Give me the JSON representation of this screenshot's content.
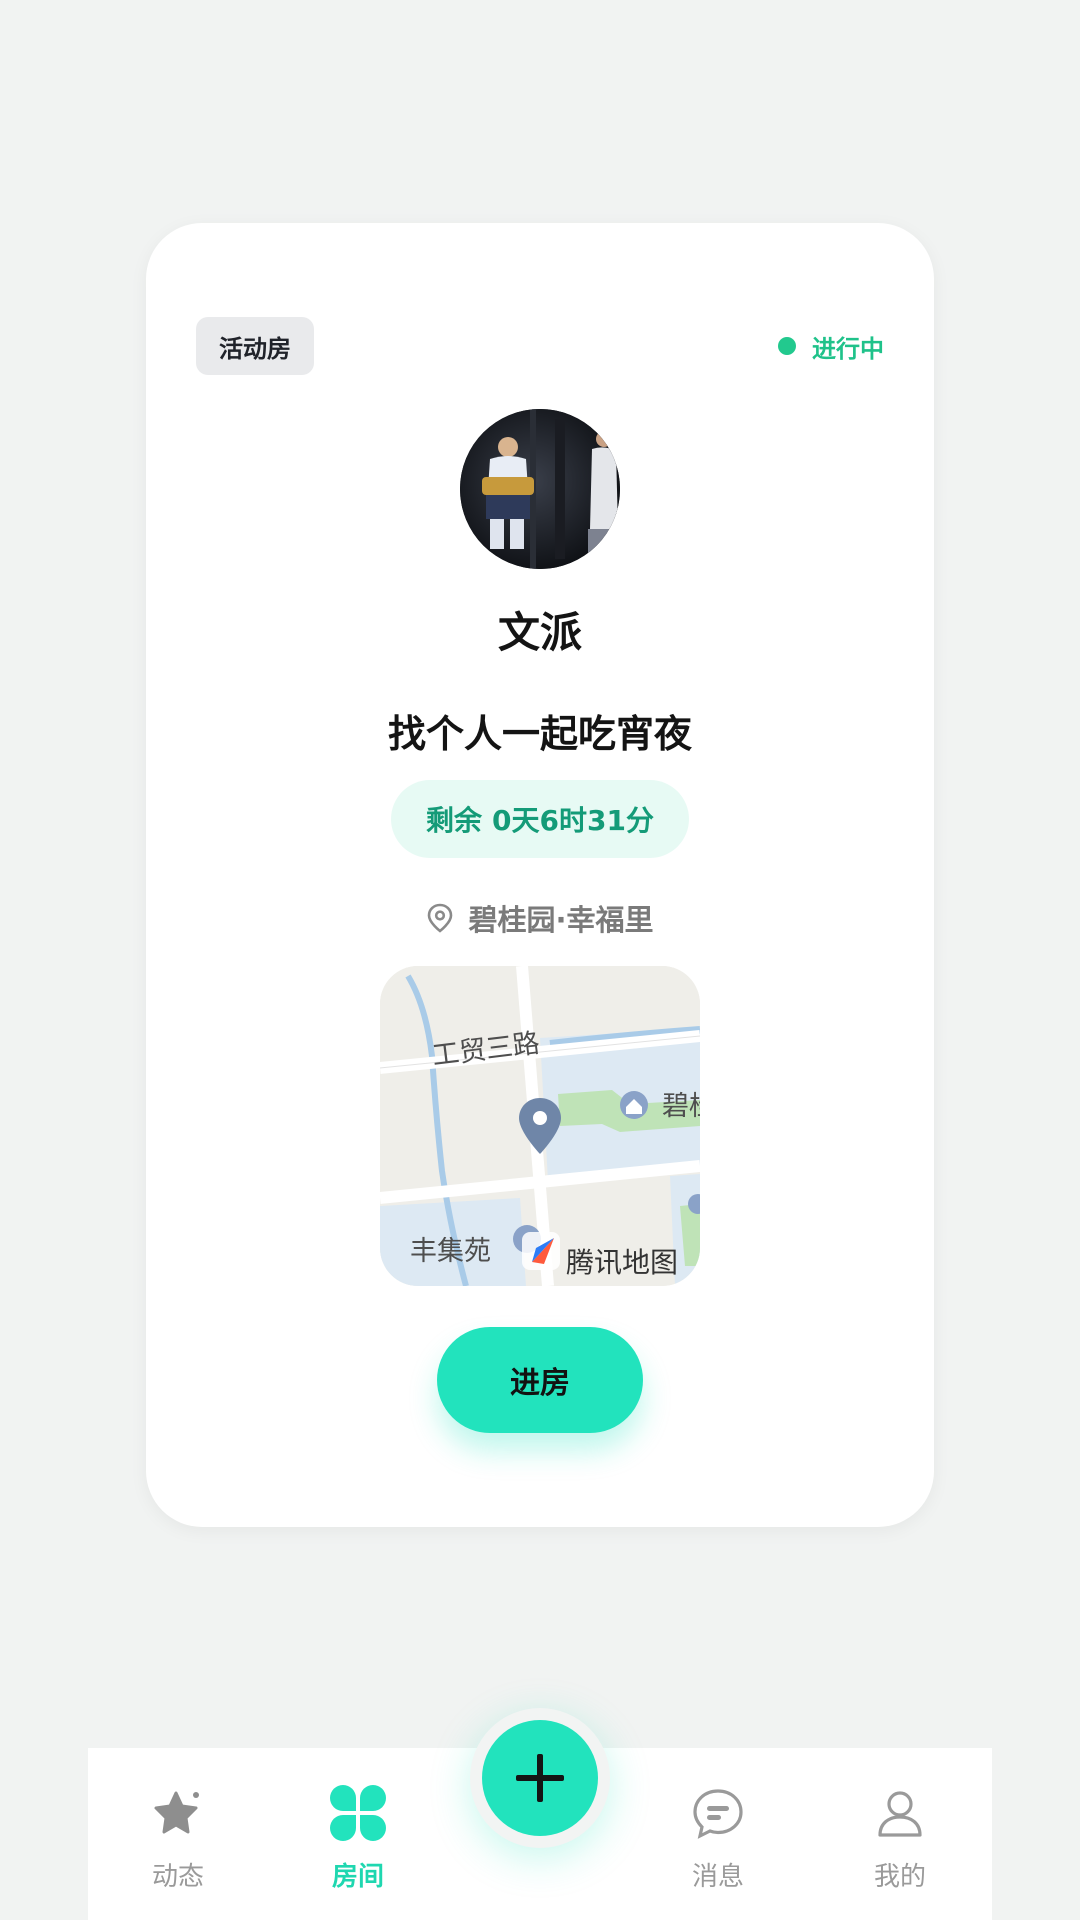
{
  "card": {
    "room_type": "活动房",
    "status": "进行中",
    "host_name": "文派",
    "title": "找个人一起吃宵夜",
    "remaining_label": "剩余",
    "remaining_value": "0天6时31分",
    "location": "碧桂园·幸福里",
    "enter_label": "进房"
  },
  "map": {
    "road_label": "工贸三路",
    "poi_1": "碧桂",
    "poi_2": "丰集苑",
    "brand": "腾讯地图"
  },
  "tabbar": {
    "items": [
      {
        "label": "动态",
        "icon": "star-icon"
      },
      {
        "label": "房间",
        "icon": "clover-icon"
      },
      {
        "label": "消息",
        "icon": "chat-bubble-icon"
      },
      {
        "label": "我的",
        "icon": "user-icon"
      }
    ],
    "active_index": 1,
    "fab_icon": "plus-icon"
  },
  "colors": {
    "accent": "#22e3bd",
    "status_green": "#22c98e",
    "timer_text": "#149b78",
    "background": "#f1f3f2"
  }
}
